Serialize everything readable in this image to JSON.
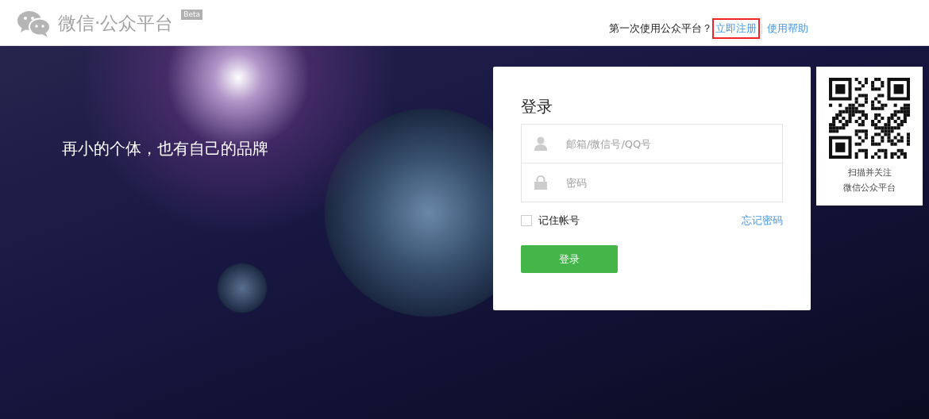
{
  "header": {
    "logo_text": "微信·公众平台",
    "badge": "Beta",
    "prompt": "第一次使用公众平台？",
    "links": [
      {
        "label": "立即注册",
        "highlighted": true
      },
      {
        "label": "使用帮助",
        "highlighted": false
      }
    ]
  },
  "hero": {
    "slogan": "再小的个体，也有自己的品牌"
  },
  "login": {
    "title": "登录",
    "fields": [
      {
        "kind": "user",
        "placeholder": "邮箱/微信号/QQ号"
      },
      {
        "kind": "password",
        "placeholder": "密码"
      }
    ],
    "remember": {
      "label": "记住帐号",
      "checked": false
    },
    "forgot": "忘记密码",
    "submit": "登录"
  },
  "qr": {
    "lines": [
      "扫描并关注",
      "微信公众平台"
    ]
  }
}
